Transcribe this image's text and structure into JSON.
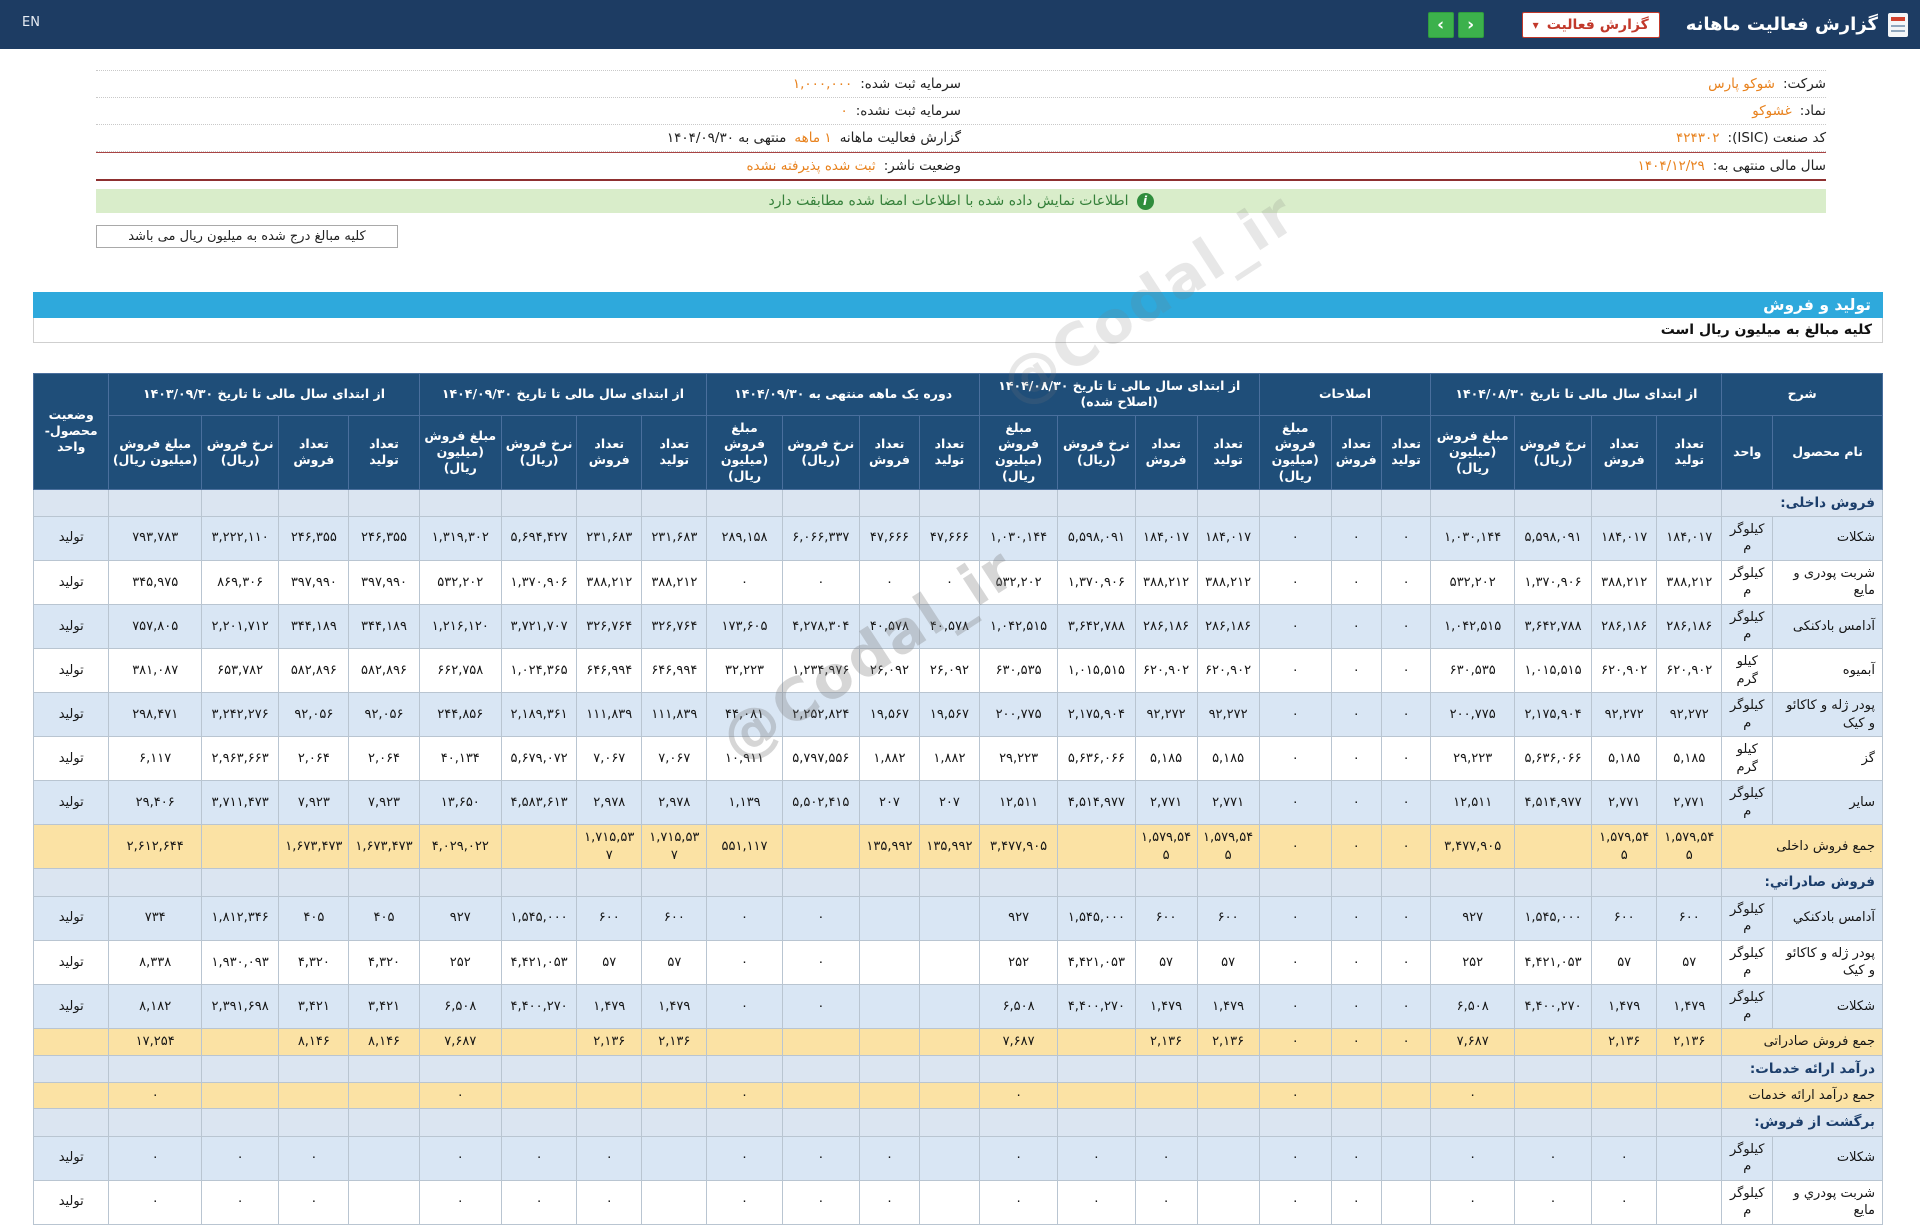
{
  "topbar": {
    "title": "گزارش فعالیت ماهانه",
    "report_dropdown": "گزارش فعالیت",
    "lang": "EN"
  },
  "info": {
    "right": [
      {
        "label": "شرکت:",
        "value": "شوکو پارس"
      },
      {
        "label": "نماد:",
        "value": "غشوکو"
      },
      {
        "label": "کد صنعت (ISIC):",
        "value": "۴۲۴۳۰۲"
      },
      {
        "label": "سال مالی منتهی به:",
        "value": "۱۴۰۴/۱۲/۲۹"
      }
    ],
    "left": [
      {
        "label": "سرمایه ثبت شده:",
        "value": "۱,۰۰۰,۰۰۰"
      },
      {
        "label": "سرمایه ثبت نشده:",
        "value": "۰"
      },
      {
        "label": "گزارش فعالیت ماهانه",
        "value": "۱ ماهه",
        "suffix": "منتهی به ۱۴۰۴/۰۹/۳۰"
      },
      {
        "label": "وضعیت ناشر:",
        "value": "ثبت شده پذیرفته نشده"
      }
    ]
  },
  "notices": {
    "signed_match": "اطلاعات نمایش داده شده با اطلاعات امضا شده مطابقت دارد",
    "amounts_note": "کلیه مبالغ درج شده به میلیون ریال می باشد"
  },
  "section": {
    "title": "تولید و فروش",
    "subtitle": "کلیه مبالغ به میلیون ریال است"
  },
  "watermark": "@Codal_ir",
  "table": {
    "header": {
      "groups": [
        {
          "label": "شرح",
          "cols": [
            "نام محصول",
            "واحد"
          ]
        },
        {
          "label": "از ابتدای سال مالی تا تاریخ ۱۴۰۴/۰۸/۳۰",
          "cols": [
            "تعداد تولید",
            "تعداد فروش",
            "نرخ فروش (ریال)",
            "مبلغ فروش (میلیون ریال)"
          ]
        },
        {
          "label": "اصلاحات",
          "cols": [
            "تعداد تولید",
            "تعداد فروش",
            "مبلغ فروش (میلیون ریال)"
          ]
        },
        {
          "label": "از ابتدای سال مالی تا تاریخ ۱۴۰۴/۰۸/۳۰ (اصلاح شده)",
          "cols": [
            "تعداد تولید",
            "تعداد فروش",
            "نرخ فروش (ریال)",
            "مبلغ فروش (میلیون ریال)"
          ]
        },
        {
          "label": "دوره یک ماهه منتهی به ۱۴۰۴/۰۹/۳۰",
          "cols": [
            "تعداد تولید",
            "تعداد فروش",
            "نرخ فروش (ریال)",
            "مبلغ فروش (میلیون ریال)"
          ]
        },
        {
          "label": "از ابتدای سال مالی تا تاریخ ۱۴۰۴/۰۹/۳۰",
          "cols": [
            "تعداد تولید",
            "تعداد فروش",
            "نرخ فروش (ریال)",
            "مبلغ فروش (میلیون ریال)"
          ]
        },
        {
          "label": "از ابتدای سال مالی تا تاریخ ۱۴۰۳/۰۹/۳۰",
          "cols": [
            "تعداد تولید",
            "تعداد فروش",
            "نرخ فروش (ریال)",
            "مبلغ فروش (میلیون ریال)"
          ]
        },
        {
          "label": "وضعیت محصول-واحد",
          "cols": []
        }
      ]
    },
    "rows": [
      {
        "type": "section",
        "name": "فروش داخلی:"
      },
      {
        "type": "data",
        "name": "شکلات",
        "unit": "کیلوگرم",
        "status": "تولید",
        "cells": [
          "۱۸۴,۰۱۷",
          "۱۸۴,۰۱۷",
          "۵,۵۹۸,۰۹۱",
          "۱,۰۳۰,۱۴۴",
          "۰",
          "۰",
          "۰",
          "۱۸۴,۰۱۷",
          "۱۸۴,۰۱۷",
          "۵,۵۹۸,۰۹۱",
          "۱,۰۳۰,۱۴۴",
          "۴۷,۶۶۶",
          "۴۷,۶۶۶",
          "۶,۰۶۶,۳۳۷",
          "۲۸۹,۱۵۸",
          "۲۳۱,۶۸۳",
          "۲۳۱,۶۸۳",
          "۵,۶۹۴,۴۲۷",
          "۱,۳۱۹,۳۰۲",
          "۲۴۶,۳۵۵",
          "۲۴۶,۳۵۵",
          "۳,۲۲۲,۱۱۰",
          "۷۹۳,۷۸۳"
        ]
      },
      {
        "type": "data",
        "name": "شربت پودری و مایع",
        "unit": "کیلوگرم",
        "status": "تولید",
        "cells": [
          "۳۸۸,۲۱۲",
          "۳۸۸,۲۱۲",
          "۱,۳۷۰,۹۰۶",
          "۵۳۲,۲۰۲",
          "۰",
          "۰",
          "۰",
          "۳۸۸,۲۱۲",
          "۳۸۸,۲۱۲",
          "۱,۳۷۰,۹۰۶",
          "۵۳۲,۲۰۲",
          "۰",
          "۰",
          "۰",
          "۰",
          "۳۸۸,۲۱۲",
          "۳۸۸,۲۱۲",
          "۱,۳۷۰,۹۰۶",
          "۵۳۲,۲۰۲",
          "۳۹۷,۹۹۰",
          "۳۹۷,۹۹۰",
          "۸۶۹,۳۰۶",
          "۳۴۵,۹۷۵"
        ]
      },
      {
        "type": "data",
        "name": "آدامس بادکنکی",
        "unit": "کیلوگرم",
        "status": "تولید",
        "cells": [
          "۲۸۶,۱۸۶",
          "۲۸۶,۱۸۶",
          "۳,۶۴۲,۷۸۸",
          "۱,۰۴۲,۵۱۵",
          "۰",
          "۰",
          "۰",
          "۲۸۶,۱۸۶",
          "۲۸۶,۱۸۶",
          "۳,۶۴۲,۷۸۸",
          "۱,۰۴۲,۵۱۵",
          "۴۰,۵۷۸",
          "۴۰,۵۷۸",
          "۴,۲۷۸,۳۰۴",
          "۱۷۳,۶۰۵",
          "۳۲۶,۷۶۴",
          "۳۲۶,۷۶۴",
          "۳,۷۲۱,۷۰۷",
          "۱,۲۱۶,۱۲۰",
          "۳۴۴,۱۸۹",
          "۳۴۴,۱۸۹",
          "۲,۲۰۱,۷۱۲",
          "۷۵۷,۸۰۵"
        ]
      },
      {
        "type": "data",
        "name": "آبمیوه",
        "unit": "کیلو گرم",
        "status": "تولید",
        "cells": [
          "۶۲۰,۹۰۲",
          "۶۲۰,۹۰۲",
          "۱,۰۱۵,۵۱۵",
          "۶۳۰,۵۳۵",
          "۰",
          "۰",
          "۰",
          "۶۲۰,۹۰۲",
          "۶۲۰,۹۰۲",
          "۱,۰۱۵,۵۱۵",
          "۶۳۰,۵۳۵",
          "۲۶,۰۹۲",
          "۲۶,۰۹۲",
          "۱,۲۳۴,۹۷۶",
          "۳۲,۲۲۳",
          "۶۴۶,۹۹۴",
          "۶۴۶,۹۹۴",
          "۱,۰۲۴,۳۶۵",
          "۶۶۲,۷۵۸",
          "۵۸۲,۸۹۶",
          "۵۸۲,۸۹۶",
          "۶۵۳,۷۸۲",
          "۳۸۱,۰۸۷"
        ]
      },
      {
        "type": "data",
        "name": "پودر ژله و کاکائو و کیک",
        "unit": "کیلوگرم",
        "status": "تولید",
        "cells": [
          "۹۲,۲۷۲",
          "۹۲,۲۷۲",
          "۲,۱۷۵,۹۰۴",
          "۲۰۰,۷۷۵",
          "۰",
          "۰",
          "۰",
          "۹۲,۲۷۲",
          "۹۲,۲۷۲",
          "۲,۱۷۵,۹۰۴",
          "۲۰۰,۷۷۵",
          "۱۹,۵۶۷",
          "۱۹,۵۶۷",
          "۲,۲۵۲,۸۲۴",
          "۴۴,۰۸۱",
          "۱۱۱,۸۳۹",
          "۱۱۱,۸۳۹",
          "۲,۱۸۹,۳۶۱",
          "۲۴۴,۸۵۶",
          "۹۲,۰۵۶",
          "۹۲,۰۵۶",
          "۳,۲۴۲,۲۷۶",
          "۲۹۸,۴۷۱"
        ]
      },
      {
        "type": "data",
        "name": "گز",
        "unit": "کیلو گرم",
        "status": "تولید",
        "cells": [
          "۵,۱۸۵",
          "۵,۱۸۵",
          "۵,۶۳۶,۰۶۶",
          "۲۹,۲۲۳",
          "۰",
          "۰",
          "۰",
          "۵,۱۸۵",
          "۵,۱۸۵",
          "۵,۶۳۶,۰۶۶",
          "۲۹,۲۲۳",
          "۱,۸۸۲",
          "۱,۸۸۲",
          "۵,۷۹۷,۵۵۶",
          "۱۰,۹۱۱",
          "۷,۰۶۷",
          "۷,۰۶۷",
          "۵,۶۷۹,۰۷۲",
          "۴۰,۱۳۴",
          "۲,۰۶۴",
          "۲,۰۶۴",
          "۲,۹۶۳,۶۶۳",
          "۶,۱۱۷"
        ]
      },
      {
        "type": "data",
        "name": "سایر",
        "unit": "کیلوگرم",
        "status": "تولید",
        "cells": [
          "۲,۷۷۱",
          "۲,۷۷۱",
          "۴,۵۱۴,۹۷۷",
          "۱۲,۵۱۱",
          "۰",
          "۰",
          "۰",
          "۲,۷۷۱",
          "۲,۷۷۱",
          "۴,۵۱۴,۹۷۷",
          "۱۲,۵۱۱",
          "۲۰۷",
          "۲۰۷",
          "۵,۵۰۲,۴۱۵",
          "۱,۱۳۹",
          "۲,۹۷۸",
          "۲,۹۷۸",
          "۴,۵۸۳,۶۱۳",
          "۱۳,۶۵۰",
          "۷,۹۲۳",
          "۷,۹۲۳",
          "۳,۷۱۱,۴۷۳",
          "۲۹,۴۰۶"
        ]
      },
      {
        "type": "total",
        "name": "جمع فروش داخلی",
        "status": "",
        "cells": [
          "۱,۵۷۹,۵۴۵",
          "۱,۵۷۹,۵۴۵",
          "",
          "۳,۴۷۷,۹۰۵",
          "۰",
          "۰",
          "۰",
          "۱,۵۷۹,۵۴۵",
          "۱,۵۷۹,۵۴۵",
          "",
          "۳,۴۷۷,۹۰۵",
          "۱۳۵,۹۹۲",
          "۱۳۵,۹۹۲",
          "",
          "۵۵۱,۱۱۷",
          "۱,۷۱۵,۵۳۷",
          "۱,۷۱۵,۵۳۷",
          "",
          "۴,۰۲۹,۰۲۲",
          "۱,۶۷۳,۴۷۳",
          "۱,۶۷۳,۴۷۳",
          "",
          "۲,۶۱۲,۶۴۴"
        ]
      },
      {
        "type": "section",
        "name": "فروش صادراتي:"
      },
      {
        "type": "data",
        "name": "آدامس بادکنکي",
        "unit": "کیلوگرم",
        "status": "تولید",
        "cells": [
          "۶۰۰",
          "۶۰۰",
          "۱,۵۴۵,۰۰۰",
          "۹۲۷",
          "۰",
          "۰",
          "۰",
          "۶۰۰",
          "۶۰۰",
          "۱,۵۴۵,۰۰۰",
          "۹۲۷",
          "",
          "",
          "۰",
          "۰",
          "۶۰۰",
          "۶۰۰",
          "۱,۵۴۵,۰۰۰",
          "۹۲۷",
          "۴۰۵",
          "۴۰۵",
          "۱,۸۱۲,۳۴۶",
          "۷۳۴"
        ]
      },
      {
        "type": "data",
        "name": "پودر ژله و کاکائو و کیک",
        "unit": "کیلوگرم",
        "status": "تولید",
        "cells": [
          "۵۷",
          "۵۷",
          "۴,۴۲۱,۰۵۳",
          "۲۵۲",
          "۰",
          "۰",
          "۰",
          "۵۷",
          "۵۷",
          "۴,۴۲۱,۰۵۳",
          "۲۵۲",
          "",
          "",
          "۰",
          "۰",
          "۵۷",
          "۵۷",
          "۴,۴۲۱,۰۵۳",
          "۲۵۲",
          "۴,۳۲۰",
          "۴,۳۲۰",
          "۱,۹۳۰,۰۹۳",
          "۸,۳۳۸"
        ]
      },
      {
        "type": "data",
        "name": "شکلات",
        "unit": "کیلوگرم",
        "status": "تولید",
        "cells": [
          "۱,۴۷۹",
          "۱,۴۷۹",
          "۴,۴۰۰,۲۷۰",
          "۶,۵۰۸",
          "۰",
          "۰",
          "۰",
          "۱,۴۷۹",
          "۱,۴۷۹",
          "۴,۴۰۰,۲۷۰",
          "۶,۵۰۸",
          "",
          "",
          "۰",
          "۰",
          "۱,۴۷۹",
          "۱,۴۷۹",
          "۴,۴۰۰,۲۷۰",
          "۶,۵۰۸",
          "۳,۴۲۱",
          "۳,۴۲۱",
          "۲,۳۹۱,۶۹۸",
          "۸,۱۸۲"
        ]
      },
      {
        "type": "total",
        "name": "جمع فروش صادراتی",
        "status": "",
        "cells": [
          "۲,۱۳۶",
          "۲,۱۳۶",
          "",
          "۷,۶۸۷",
          "۰",
          "۰",
          "۰",
          "۲,۱۳۶",
          "۲,۱۳۶",
          "",
          "۷,۶۸۷",
          "",
          "",
          "",
          "",
          "۲,۱۳۶",
          "۲,۱۳۶",
          "",
          "۷,۶۸۷",
          "۸,۱۴۶",
          "۸,۱۴۶",
          "",
          "۱۷,۲۵۴"
        ]
      },
      {
        "type": "section",
        "name": "درآمد ارائه خدمات:"
      },
      {
        "type": "total",
        "name": "جمع درآمد ارائه خدمات",
        "status": "",
        "cells": [
          "",
          "",
          "",
          "۰",
          "",
          "",
          "۰",
          "",
          "",
          "",
          "۰",
          "",
          "",
          "",
          "۰",
          "",
          "",
          "",
          "۰",
          "",
          "",
          "",
          "۰"
        ]
      },
      {
        "type": "section",
        "name": "برگشت از فروش:"
      },
      {
        "type": "data",
        "name": "شکلات",
        "unit": "کیلوگرم",
        "status": "تولید",
        "cells": [
          "",
          "۰",
          "۰",
          "۰",
          "",
          "۰",
          "۰",
          "",
          "۰",
          "۰",
          "۰",
          "",
          "۰",
          "۰",
          "۰",
          "",
          "۰",
          "۰",
          "۰",
          "",
          "۰",
          "۰",
          "۰"
        ]
      },
      {
        "type": "data",
        "name": "شربت پودري و مایع",
        "unit": "کیلوگرم",
        "status": "تولید",
        "cells": [
          "",
          "۰",
          "۰",
          "۰",
          "",
          "۰",
          "۰",
          "",
          "۰",
          "۰",
          "۰",
          "",
          "۰",
          "۰",
          "۰",
          "",
          "۰",
          "۰",
          "۰",
          "",
          "۰",
          "۰",
          "۰"
        ]
      }
    ]
  }
}
